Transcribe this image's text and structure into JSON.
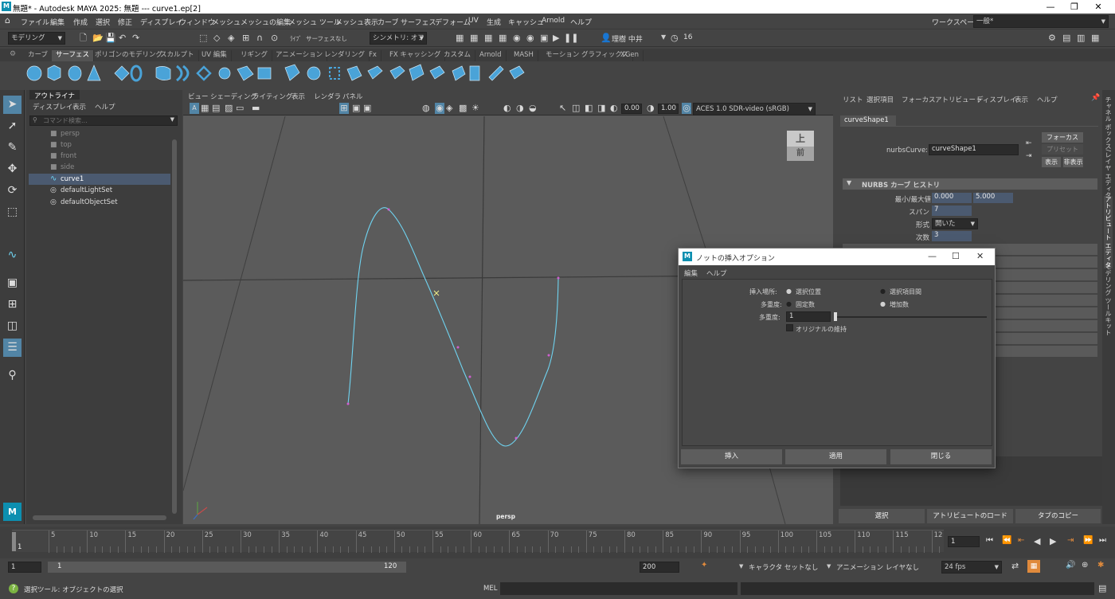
{
  "titlebar": {
    "title": "無題* - Autodesk MAYA 2025: 無題   ---   curve1.ep[2]",
    "logo": "M",
    "min": "—",
    "max": "❐",
    "close": "✕"
  },
  "menus": [
    "ファイル",
    "編集",
    "作成",
    "選択",
    "修正",
    "ディスプレイ",
    "ウィンドウ",
    "メッシュ",
    "メッシュの編集",
    "メッシュ ツール",
    "メッシュ表示",
    "カーブ",
    "サーフェス",
    "デフォーム",
    "UV",
    "生成",
    "キャッシュ",
    "Arnold",
    "ヘルプ"
  ],
  "workspace": {
    "label": "ワークスペース:",
    "value": "一般*"
  },
  "status": {
    "mode": "モデリング",
    "live_label": "ﾗｲﾌﾞ",
    "live_value": "サーフェスなし",
    "symmetry": "シンメトリ: オフ",
    "user": "理樹 中井",
    "notifications": "16"
  },
  "shelf_tabs": [
    "カーブ",
    "サーフェス",
    "ポリゴンのモデリング",
    "スカルプト",
    "UV 編集",
    "リギング",
    "アニメーション",
    "レンダリング",
    "Fx",
    "FX キャッシング",
    "カスタム",
    "Arnold",
    "MASH",
    "モーション グラフィックス",
    "XGen"
  ],
  "shelf_active": "サーフェス",
  "outliner": {
    "tab": "アウトライナ",
    "menus": [
      "ディスプレイ",
      "表示",
      "ヘルプ"
    ],
    "search_placeholder": "コマンド検索...",
    "items": [
      {
        "label": "persp",
        "dim": true
      },
      {
        "label": "top",
        "dim": true
      },
      {
        "label": "front",
        "dim": true
      },
      {
        "label": "side",
        "dim": true
      },
      {
        "label": "curve1",
        "dim": false,
        "selected": true
      },
      {
        "label": "defaultLightSet",
        "dim": false
      },
      {
        "label": "defaultObjectSet",
        "dim": false
      }
    ]
  },
  "viewport": {
    "menus": [
      "ビュー",
      "シェーディング",
      "ライティング",
      "表示",
      "レンダラ",
      "パネル"
    ],
    "exposure": "0.00",
    "gamma": "1.00",
    "colorspace": "ACES 1.0 SDR-video (sRGB)",
    "camera": "persp",
    "viewcube_top": "上",
    "viewcube_front": "前"
  },
  "attribute_editor": {
    "menus": [
      "リスト",
      "選択項目",
      "フォーカス",
      "アトリビュート",
      "ディスプレイ",
      "表示",
      "ヘルプ"
    ],
    "node_tab": "curveShape1",
    "node_label": "nurbsCurve:",
    "node_value": "curveShape1",
    "btn_focus": "フォーカス",
    "btn_preset": "プリセット",
    "btn_show": "表示",
    "btn_hide": "非表示",
    "section": "NURBS カーブ ヒストリ",
    "min_max_label": "最小/最大値",
    "min": "0.000",
    "max": "5.000",
    "spans_label": "スパン",
    "spans": "7",
    "form_label": "形式",
    "form": "開いた",
    "degree_label": "次数",
    "degree": "3",
    "bottom_buttons": [
      "選択",
      "アトリビュートのロード",
      "タブのコピー"
    ]
  },
  "vertical_tabs": [
    "チャネル ボックス/レイヤ エディタ",
    "アトリビュート エディタ",
    "モデリング ツールキット"
  ],
  "dialog": {
    "title": "ノットの挿入オプション",
    "logo": "M",
    "menus": [
      "編集",
      "ヘルプ"
    ],
    "insert_label": "挿入場所:",
    "insert_opt1": "選択位置",
    "insert_opt2": "選択項目間",
    "mult_label": "多重度:",
    "mult_opt1": "固定数",
    "mult_opt2": "増加数",
    "mult_value_label": "多重度:",
    "mult_value": "1",
    "keep_original": "オリジナルの維持",
    "buttons": [
      "挿入",
      "適用",
      "閉じる"
    ]
  },
  "timeline": {
    "ticks": [
      "5",
      "10",
      "15",
      "20",
      "25",
      "30",
      "35",
      "40",
      "45",
      "50",
      "55",
      "60",
      "65",
      "70",
      "75",
      "80",
      "85",
      "90",
      "95",
      "100",
      "105",
      "110",
      "115",
      "12"
    ],
    "start_frame": "1",
    "current_frame": "1"
  },
  "range": {
    "start": "1",
    "inner_start": "1",
    "inner_end": "120",
    "end": "200",
    "character_set": "キャラクタ セットなし",
    "anim_layer": "アニメーション レイヤなし",
    "fps": "24 fps"
  },
  "command": {
    "help": "選択ツール: オブジェクトの選択",
    "lang": "MEL"
  },
  "colors": {
    "accent": "#5285a6",
    "curve": "#6fd3f0",
    "selected_row": "#4b5a70"
  }
}
